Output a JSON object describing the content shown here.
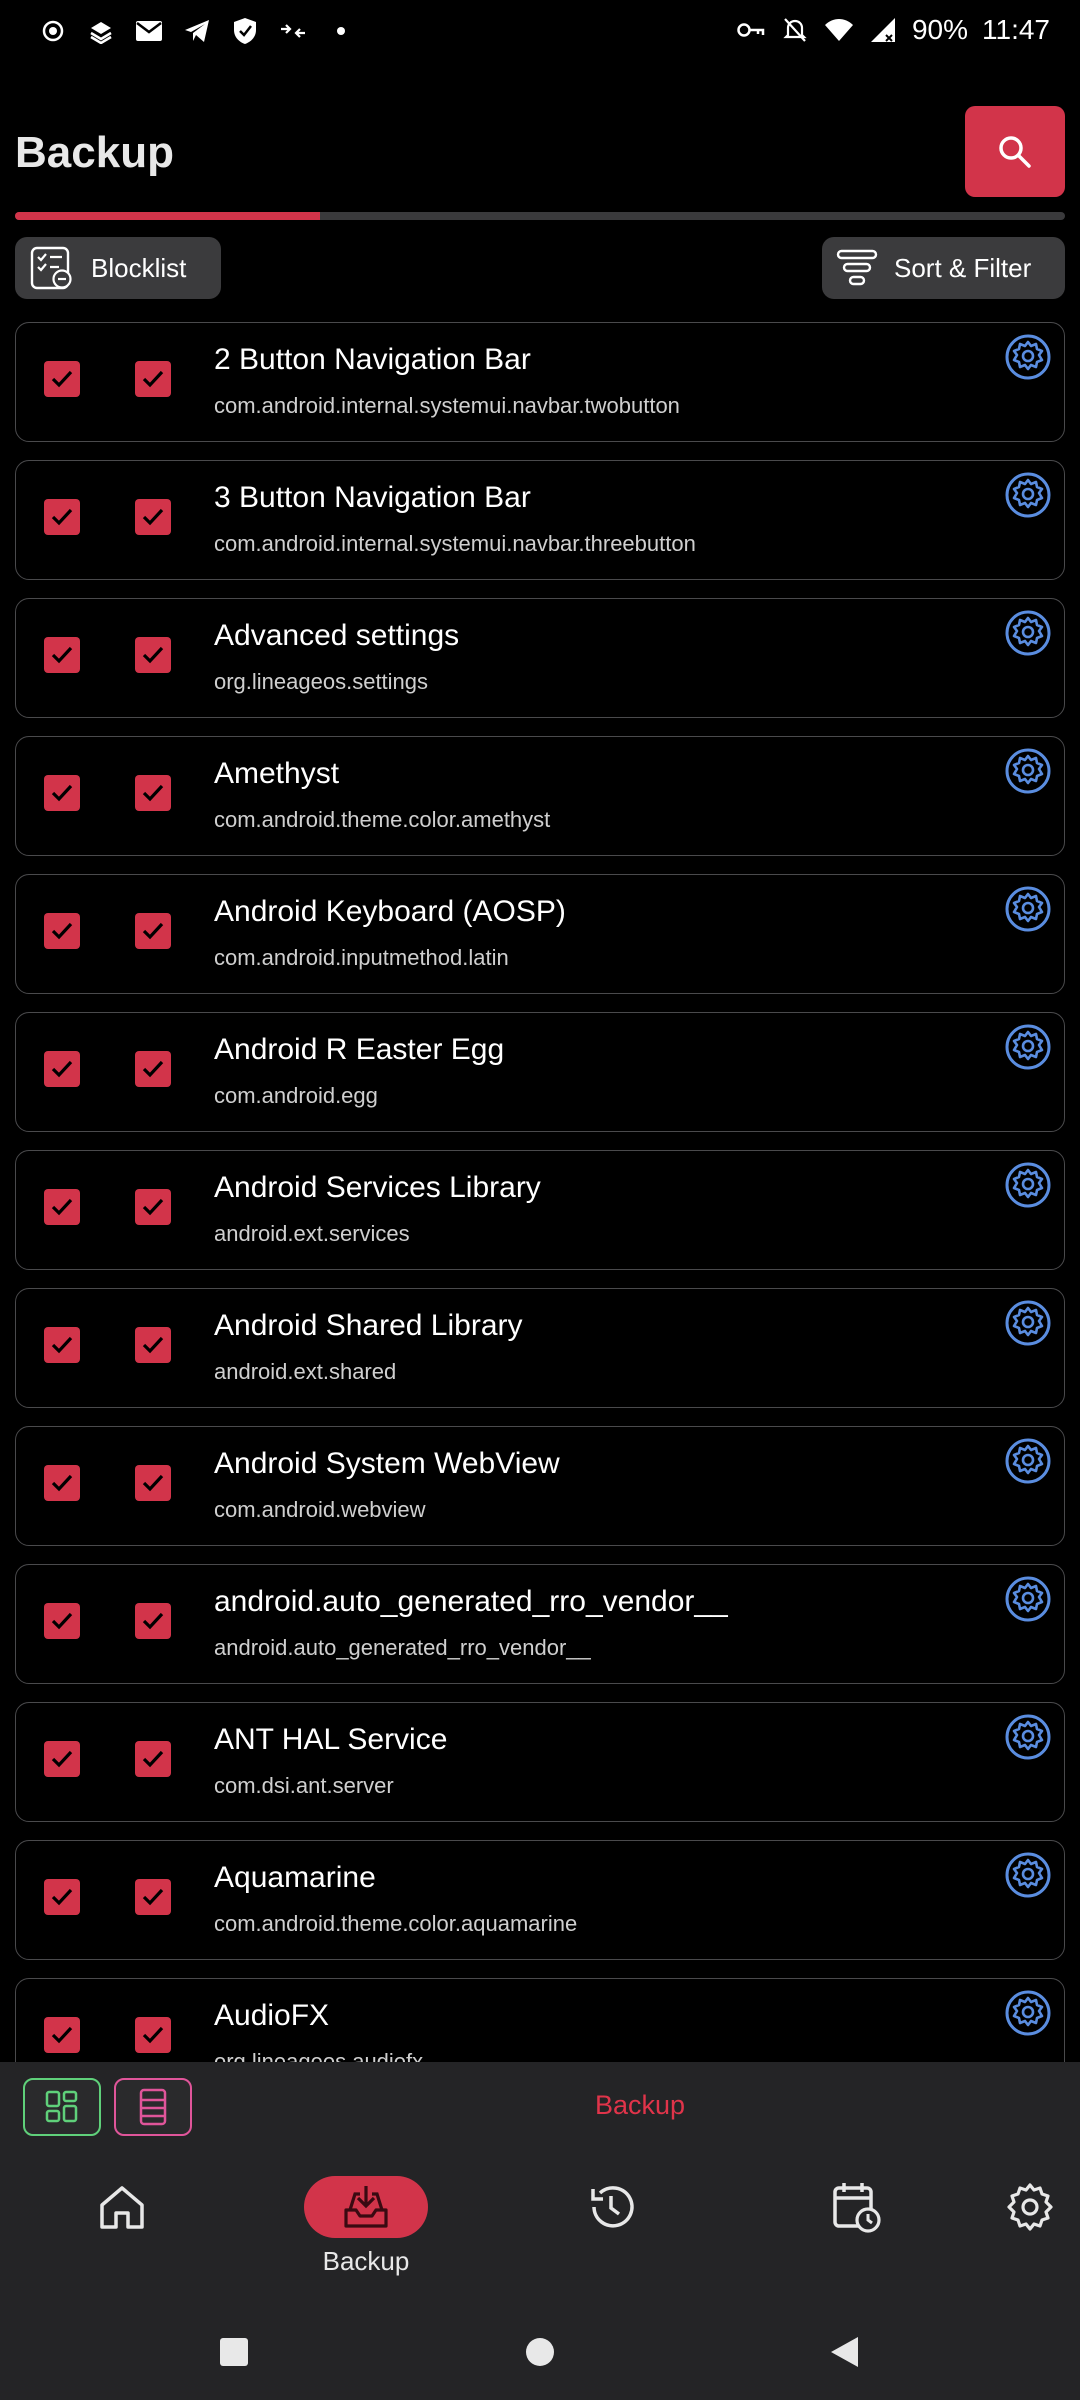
{
  "status_bar": {
    "battery": "90%",
    "time": "11:47",
    "left_icons": [
      "record-icon",
      "stack-icon",
      "mail-icon",
      "telegram-icon",
      "shield-icon",
      "compress-icon",
      "dot-icon"
    ],
    "right_icons": [
      "vpn-key-icon",
      "bell-off-icon",
      "wifi-icon",
      "signal-icon"
    ]
  },
  "header": {
    "title": "Backup",
    "search_icon": "search-icon",
    "progress_fraction": 0.29
  },
  "chips": {
    "blocklist_label": "Blocklist",
    "sort_filter_label": "Sort & Filter"
  },
  "items": [
    {
      "name": "2 Button Navigation Bar",
      "package": "com.android.internal.systemui.navbar.twobutton"
    },
    {
      "name": "3 Button Navigation Bar",
      "package": "com.android.internal.systemui.navbar.threebutton"
    },
    {
      "name": "Advanced settings",
      "package": "org.lineageos.settings"
    },
    {
      "name": "Amethyst",
      "package": "com.android.theme.color.amethyst"
    },
    {
      "name": "Android Keyboard (AOSP)",
      "package": "com.android.inputmethod.latin"
    },
    {
      "name": "Android R Easter Egg",
      "package": "com.android.egg"
    },
    {
      "name": "Android Services Library",
      "package": "android.ext.services"
    },
    {
      "name": "Android Shared Library",
      "package": "android.ext.shared"
    },
    {
      "name": "Android System WebView",
      "package": "com.android.webview"
    },
    {
      "name": "android.auto_generated_rro_vendor__",
      "package": "android.auto_generated_rro_vendor__"
    },
    {
      "name": "ANT HAL Service",
      "package": "com.dsi.ant.server"
    },
    {
      "name": "Aquamarine",
      "package": "com.android.theme.color.aquamarine"
    },
    {
      "name": "AudioFX",
      "package": "org.lineageos.audiofx"
    }
  ],
  "bottom_bar": {
    "title": "Backup"
  },
  "nav": {
    "active_label": "Backup",
    "items": [
      "home-icon",
      "backup-icon",
      "history-icon",
      "scheduler-icon",
      "settings-icon"
    ]
  },
  "colors": {
    "accent": "#d2344a",
    "system_app_icon": "#5a8de0",
    "mode_green": "#5fd07a",
    "mode_pink": "#e0559a"
  }
}
